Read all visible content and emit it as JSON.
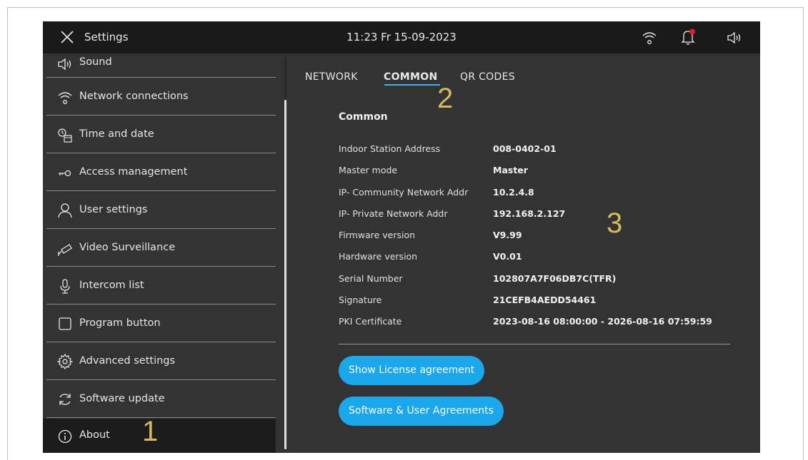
{
  "topbar": {
    "title": "Settings",
    "clock": "11:23  Fr 15-09-2023"
  },
  "sidebar": {
    "items": [
      {
        "label": "Sound",
        "icon": "speaker-icon"
      },
      {
        "label": "Network connections",
        "icon": "wifi-icon"
      },
      {
        "label": "Time and date",
        "icon": "clock-calendar-icon"
      },
      {
        "label": "Access  management",
        "icon": "key-icon"
      },
      {
        "label": "User settings",
        "icon": "user-icon"
      },
      {
        "label": "Video Surveillance",
        "icon": "camera-icon"
      },
      {
        "label": "Intercom list",
        "icon": "microphone-icon"
      },
      {
        "label": "Program button",
        "icon": "square-icon"
      },
      {
        "label": "Advanced settings",
        "icon": "gear-icon"
      },
      {
        "label": "Software update",
        "icon": "refresh-icon"
      },
      {
        "label": "About",
        "icon": "info-icon",
        "active": true
      }
    ]
  },
  "tabs": [
    {
      "label": "NETWORK"
    },
    {
      "label": "COMMON",
      "active": true
    },
    {
      "label": "QR CODES"
    }
  ],
  "common": {
    "heading": "Common",
    "rows": [
      {
        "label": "Indoor Station Address",
        "value": "008-0402-01"
      },
      {
        "label": "Master mode",
        "value": "Master"
      },
      {
        "label": "IP- Community Network Addr",
        "value": "10.2.4.8"
      },
      {
        "label": "IP- Private Network Addr",
        "value": "192.168.2.127"
      },
      {
        "label": "Firmware version",
        "value": "V9.99"
      },
      {
        "label": "Hardware version",
        "value": "V0.01"
      },
      {
        "label": "Serial Number",
        "value": "102807A7F06DB7C(TFR)"
      },
      {
        "label": "Signature",
        "value": "21CEFB4AEDD54461"
      },
      {
        "label": "PKI Certificate",
        "value": "2023-08-16 08:00:00 - 2026-08-16 07:59:59"
      }
    ]
  },
  "buttons": {
    "license": "Show License agreement",
    "software_agreements": "Software & User Agreements"
  },
  "annotations": {
    "one": "1",
    "two": "2",
    "three": "3"
  },
  "colors": {
    "accent": "#1aa7ec",
    "notification": "#e0202a",
    "annotation": "#d7b95a"
  }
}
